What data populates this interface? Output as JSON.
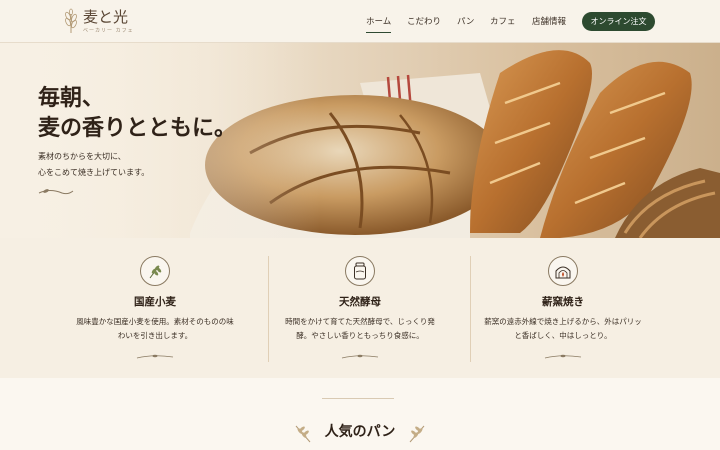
{
  "brand": {
    "name": "麦と光",
    "tagline": "ベーカリー カフェ"
  },
  "nav": {
    "items": [
      {
        "label": "ホーム",
        "active": true
      },
      {
        "label": "こだわり",
        "active": false
      },
      {
        "label": "パン",
        "active": false
      },
      {
        "label": "カフェ",
        "active": false
      },
      {
        "label": "店舗情報",
        "active": false
      }
    ],
    "order_label": "オンライン注文"
  },
  "hero": {
    "title_line1": "毎朝、",
    "title_line2": "麦の香りとともに。",
    "desc_line1": "素材のちからを大切に、",
    "desc_line2": "心をこめて焼き上げています。"
  },
  "features": [
    {
      "icon": "wheat-icon",
      "title": "国産小麦",
      "desc_line1": "風味豊かな国産小麦を使用。素材そのものの味",
      "desc_line2": "わいを引き出します。"
    },
    {
      "icon": "jar-icon",
      "title": "天然酵母",
      "desc_line1": "時間をかけて育てた天然酵母で、じっくり発",
      "desc_line2": "酵。やさしい香りともっちり食感に。"
    },
    {
      "icon": "oven-icon",
      "title": "薪窯焼き",
      "desc_line1": "薪窯の遠赤外線で焼き上げるから、外はパリッ",
      "desc_line2": "と香ばしく、中はしっとり。"
    }
  ],
  "popular": {
    "title": "人気のパン"
  },
  "colors": {
    "accent": "#2d4a30",
    "background": "#f6efe3",
    "text": "#3b2f25"
  }
}
